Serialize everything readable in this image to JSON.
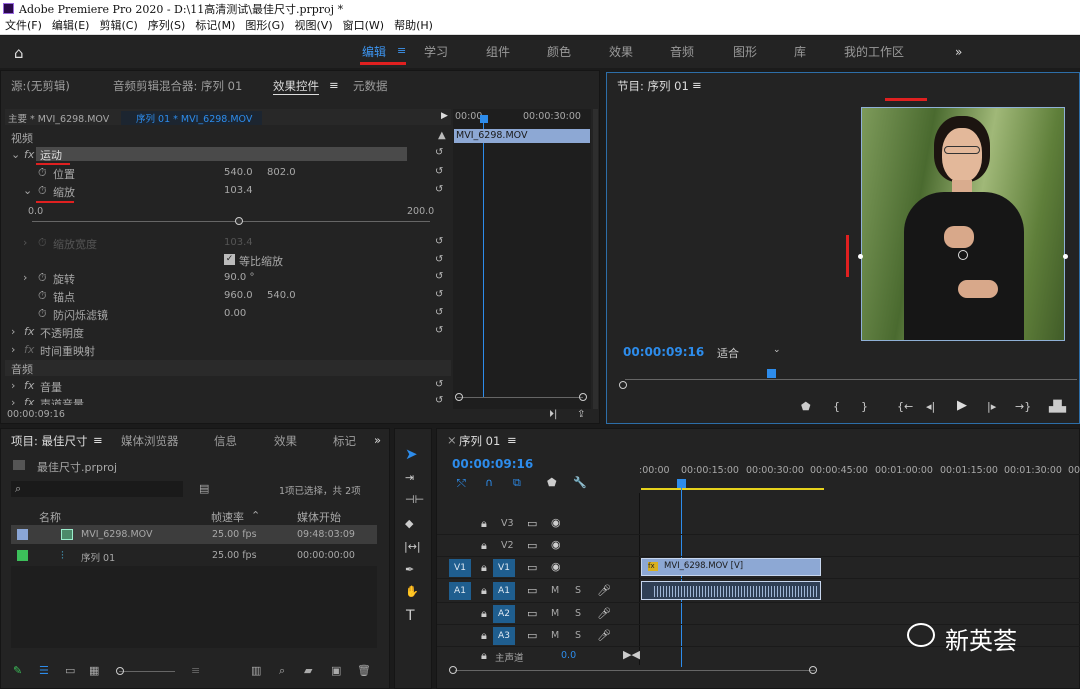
{
  "title_bar": {
    "text": "Adobe Premiere Pro 2020 - D:\\11高清测试\\最佳尺寸.prproj *"
  },
  "menu": [
    "文件(F)",
    "编辑(E)",
    "剪辑(C)",
    "序列(S)",
    "标记(M)",
    "图形(G)",
    "视图(V)",
    "窗口(W)",
    "帮助(H)"
  ],
  "workspaces": [
    "编辑",
    "学习",
    "组件",
    "颜色",
    "效果",
    "音频",
    "图形",
    "库",
    "我的工作区"
  ],
  "source_panel": {
    "tabs": [
      "源:(无剪辑)",
      "音频剪辑混合器: 序列 01",
      "效果控件",
      "元数据"
    ],
    "master": "主要 * MVI_6298.MOV",
    "sequence_clip": "序列 01 * MVI_6298.MOV",
    "ruler_start": "00:00",
    "ruler_end": "00:00:30:00",
    "clip_name": "MVI_6298.MOV",
    "video_label": "视频",
    "motion": "运动",
    "position": "位置",
    "pos_x": "540.0",
    "pos_y": "802.0",
    "scale": "缩放",
    "scale_val": "103.4",
    "slider_min": "0.0",
    "slider_max": "200.0",
    "scale_width": "缩放宽度",
    "scale_width_val": "103.4",
    "uniform": "等比缩放",
    "rotation": "旋转",
    "rotation_val": "90.0 °",
    "anchor": "锚点",
    "anchor_x": "960.0",
    "anchor_y": "540.0",
    "flicker": "防闪烁滤镜",
    "flicker_val": "0.00",
    "opacity": "不透明度",
    "time_remap": "时间重映射",
    "audio_label": "音频",
    "volume": "音量",
    "channel_volume": "声道音量",
    "timecode": "00:00:09:16"
  },
  "program": {
    "title": "节目: 序列 01",
    "timecode": "00:00:09:16",
    "fit": "适合"
  },
  "project": {
    "tabs": [
      "项目: 最佳尺寸",
      "媒体浏览器",
      "信息",
      "效果",
      "标记"
    ],
    "file": "最佳尺寸.prproj",
    "selection_info": "1项已选择，共 2项",
    "col_name": "名称",
    "col_fps": "帧速率",
    "col_start": "媒体开始",
    "items": [
      {
        "name": "MVI_6298.MOV",
        "fps": "25.00 fps",
        "start": "09:48:03:09",
        "color": "#8aa6d6"
      },
      {
        "name": "序列 01",
        "fps": "25.00 fps",
        "start": "00:00:00:00",
        "color": "#3cbf5a"
      }
    ]
  },
  "timeline": {
    "tab": "序列 01",
    "timecode": "00:00:09:16",
    "ruler": [
      ":00:00",
      "00:00:15:00",
      "00:00:30:00",
      "00:00:45:00",
      "00:01:00:00",
      "00:01:15:00",
      "00:01:30:00",
      "00:"
    ],
    "video_tracks": [
      "V3",
      "V2",
      "V1"
    ],
    "audio_tracks": [
      "A1",
      "A2",
      "A3"
    ],
    "source_v": "V1",
    "source_a": "A1",
    "master": "主声道",
    "master_val": "0.0",
    "clip_video": "MVI_6298.MOV [V]",
    "m": "M",
    "s": "S"
  },
  "watermark": "新英荟"
}
